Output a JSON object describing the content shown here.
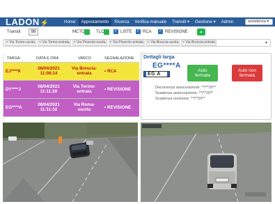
{
  "nav": {
    "logo": "LADON",
    "items": [
      "Home",
      "Appostamento",
      "Ricerca",
      "Verifica manuale",
      "Transiti ▾",
      "Gestione ▾",
      "Admin"
    ],
    "active_index": 1,
    "user": "assistenza ▾"
  },
  "filters": {
    "transiti_label": "Transiti",
    "transiti_count": "98",
    "mctc_label": "MCTC",
    "tlc_label": "TLC",
    "liste_label": "LISTE",
    "rca_label": "RCA",
    "revisione_label": "REVISIONE",
    "arrow": "▲",
    "tags": [
      "× Via Torino-uscita",
      "× Via Torino-entrata",
      "× Via Pinerolo-uscita",
      "× Via Pinerolo-entrata",
      "× Via Brescia-uscita",
      "× Via Brescia-entrata"
    ],
    "caret": "▾"
  },
  "table": {
    "headers": [
      "TARGA",
      "DATA E ORA",
      "VARCO",
      "SEGNALAZIONE"
    ],
    "rows": [
      {
        "plate": "EJ****K",
        "date": "08/04/2021",
        "time": "11:08:14",
        "varco1": "Via Brescia-",
        "varco2": "entrata",
        "sig": "• RCA"
      },
      {
        "plate": "DY****J",
        "date": "08/04/2021",
        "time": "11:11:20",
        "varco1": "Via Torino-",
        "varco2": "entrata",
        "sig": "• REVISIONE"
      },
      {
        "plate": "EG****A",
        "date": "08/04/2021",
        "time": "11:11:32",
        "varco1": "Via Roma-",
        "varco2": "uscita",
        "sig": "• REVISIONE"
      }
    ]
  },
  "details": {
    "title": "Dettagli targa",
    "plate": "EG****A",
    "plate_img_text": "EG  A",
    "btn_stop_1": "Auto",
    "btn_stop_2": "fermata",
    "btn_nostop_1": "Auto non",
    "btn_nostop_2": "fermata",
    "info": [
      "Decorrenza assicurazione: **/**20**",
      "Scadenza assicurazione: **/**20**",
      "Scadenza revisione: **/**20**"
    ]
  },
  "colors": {
    "nav_bg": "#2a5d9a",
    "row_rca": "#f4e53c",
    "row_revisione": "#c15fc4",
    "stop_green": "#46b650",
    "nostop_red": "#dc3b3b"
  }
}
